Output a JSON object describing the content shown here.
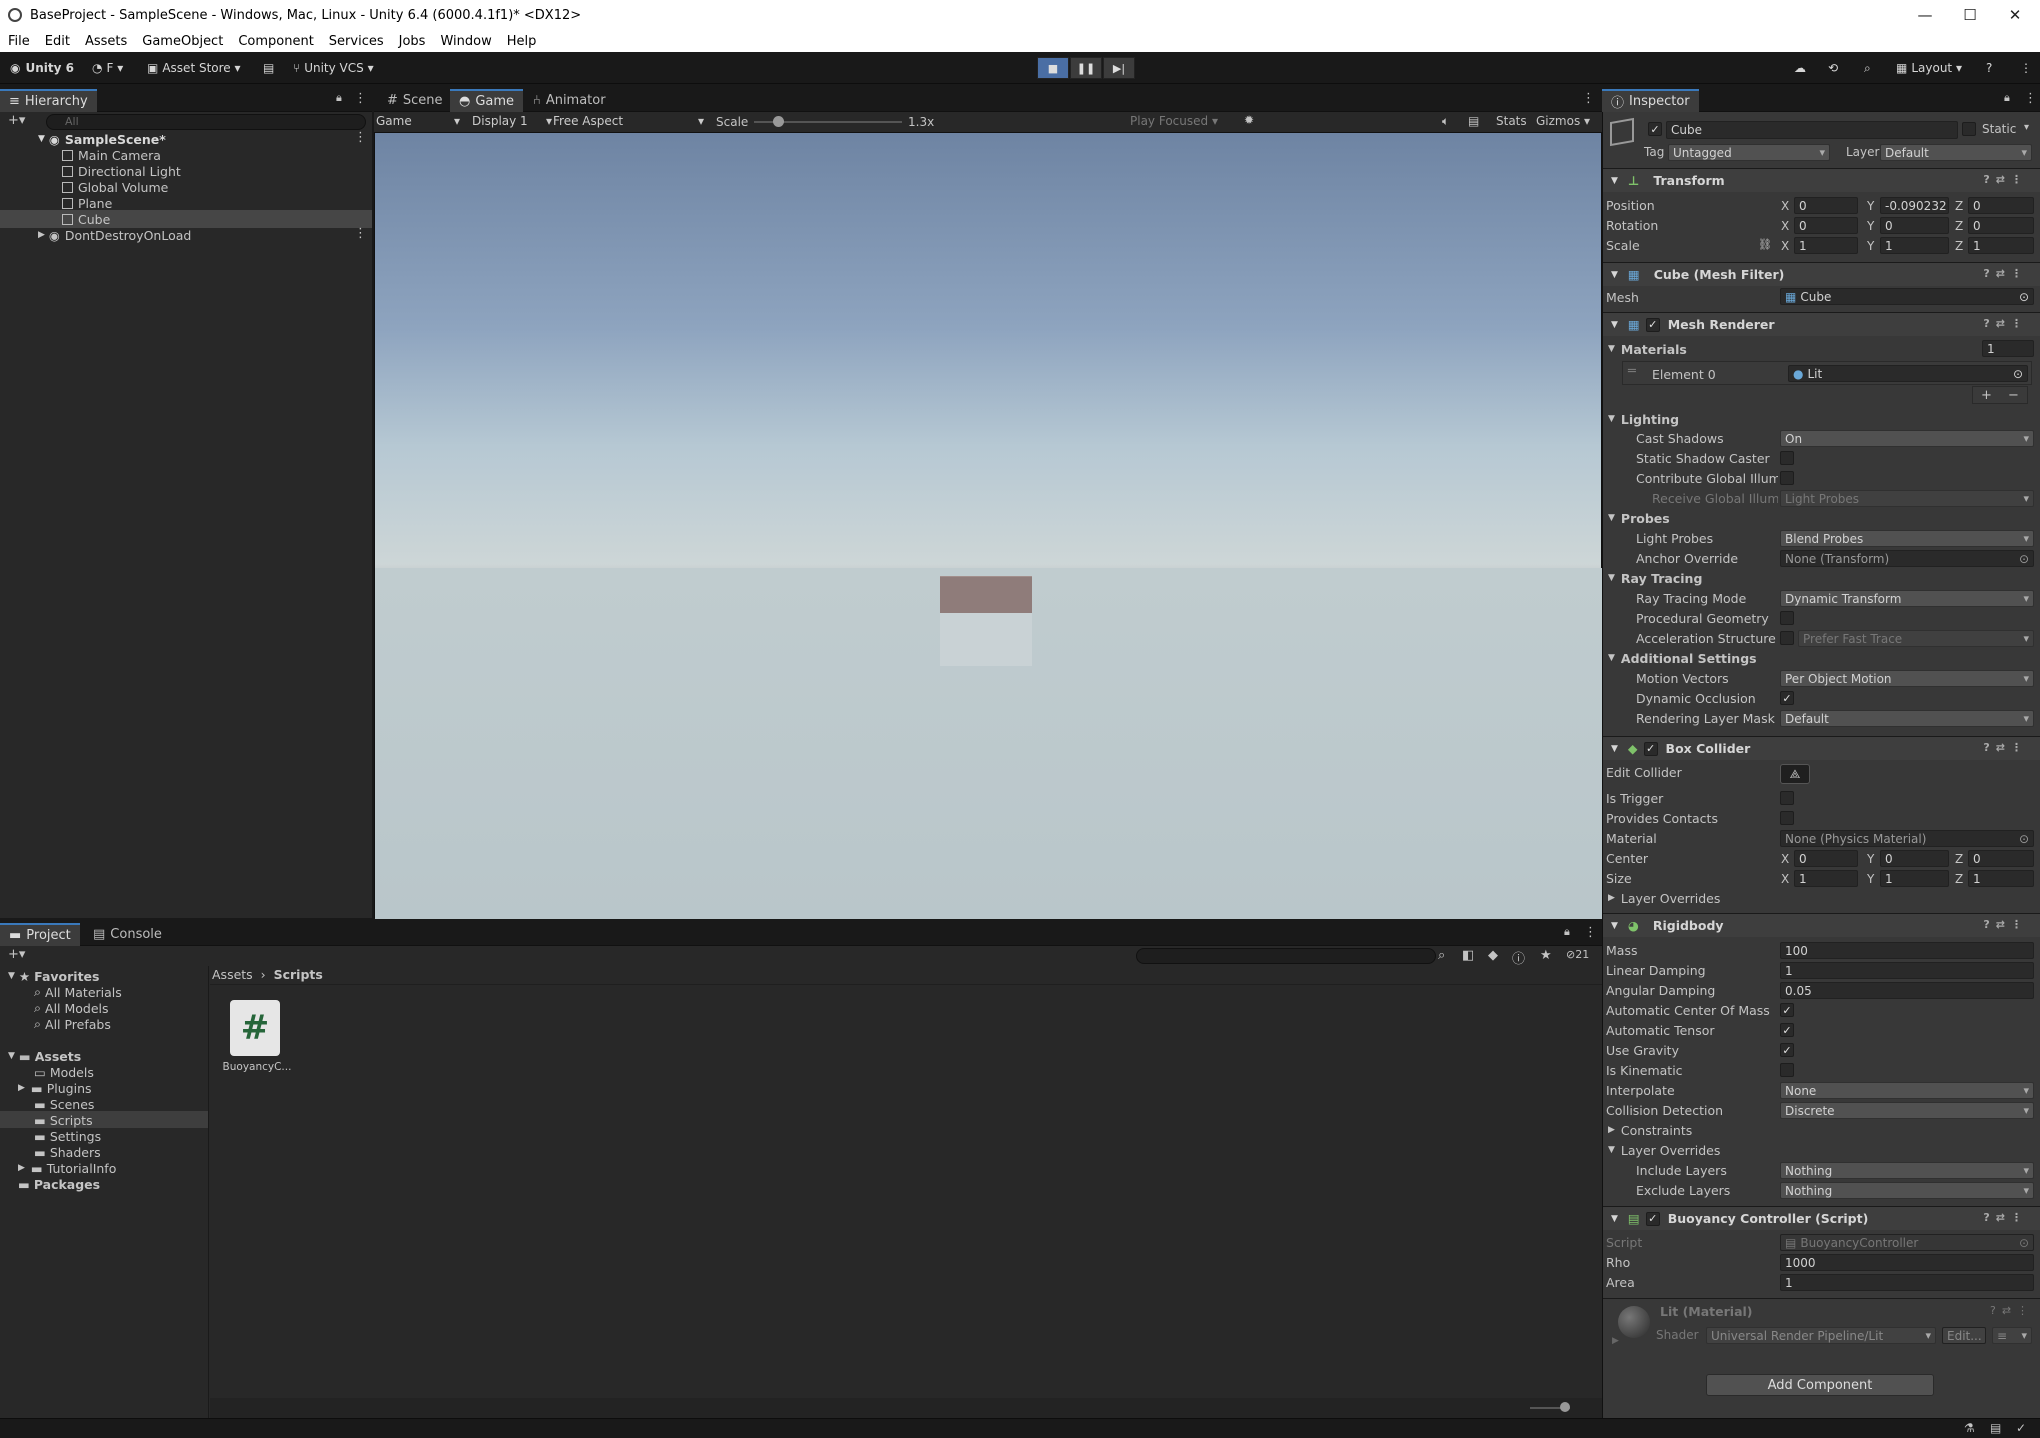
{
  "window": {
    "title": "BaseProject - SampleScene - Windows, Mac, Linux - Unity 6.4 (6000.4.1f1)* <DX12>"
  },
  "menu": [
    "File",
    "Edit",
    "Assets",
    "GameObject",
    "Component",
    "Services",
    "Jobs",
    "Window",
    "Help"
  ],
  "toolbar": {
    "unity": "Unity 6",
    "account": "F",
    "asset_store": "Asset Store",
    "vcs": "Unity VCS",
    "layout": "Layout"
  },
  "hierarchy": {
    "tab": "Hierarchy",
    "search_placeholder": "All",
    "scene": "SampleScene*",
    "items": [
      "Main Camera",
      "Directional Light",
      "Global Volume",
      "Plane",
      "Cube"
    ],
    "ddol": "DontDestroyOnLoad"
  },
  "center_tabs": [
    "Scene",
    "Game",
    "Animator"
  ],
  "game_bar": {
    "mode": "Game",
    "display": "Display 1",
    "aspect": "Free Aspect",
    "scale_label": "Scale",
    "scale_value": "1.3x",
    "play_focused": "Play Focused",
    "stats": "Stats",
    "gizmos": "Gizmos"
  },
  "project": {
    "tabs": [
      "Project",
      "Console"
    ],
    "hidden_count": "21",
    "favorites": "Favorites",
    "fav_items": [
      "All Materials",
      "All Models",
      "All Prefabs"
    ],
    "assets": "Assets",
    "folders": [
      "Models",
      "Plugins",
      "Scenes",
      "Scripts",
      "Settings",
      "Shaders",
      "TutorialInfo"
    ],
    "packages": "Packages",
    "breadcrumb": [
      "Assets",
      "Scripts"
    ],
    "file": "BuoyancyC..."
  },
  "inspector": {
    "tab": "Inspector",
    "object": "Cube",
    "static": "Static",
    "tag_label": "Tag",
    "tag": "Untagged",
    "layer_label": "Layer",
    "layer": "Default",
    "transform": {
      "title": "Transform",
      "position": "Position",
      "rotation": "Rotation",
      "scale": "Scale",
      "pos": [
        "0",
        "-0.090232",
        "0"
      ],
      "rot": [
        "0",
        "0",
        "0"
      ],
      "scl": [
        "1",
        "1",
        "1"
      ]
    },
    "mesh_filter": {
      "title": "Cube (Mesh Filter)",
      "mesh_label": "Mesh",
      "mesh": "Cube"
    },
    "mesh_renderer": {
      "title": "Mesh Renderer",
      "materials": "Materials",
      "count": "1",
      "element": "Element 0",
      "lit": "Lit",
      "lighting": "Lighting",
      "cast_shadows": "Cast Shadows",
      "cast_val": "On",
      "static_caster": "Static Shadow Caster",
      "contribute_gi": "Contribute Global Illumina",
      "receive_gi": "Receive Global Illumina",
      "receive_val": "Light Probes",
      "probes": "Probes",
      "light_probes": "Light Probes",
      "light_probes_val": "Blend Probes",
      "anchor": "Anchor Override",
      "anchor_val": "None (Transform)",
      "ray_tracing": "Ray Tracing",
      "rt_mode": "Ray Tracing Mode",
      "rt_mode_val": "Dynamic Transform",
      "procedural": "Procedural Geometry",
      "accel": "Acceleration Structure Bu",
      "accel_val": "Prefer Fast Trace",
      "additional": "Additional Settings",
      "motion": "Motion Vectors",
      "motion_val": "Per Object Motion",
      "occlusion": "Dynamic Occlusion",
      "rlm": "Rendering Layer Mask",
      "rlm_val": "Default"
    },
    "box_collider": {
      "title": "Box Collider",
      "edit": "Edit Collider",
      "trigger": "Is Trigger",
      "contacts": "Provides Contacts",
      "material": "Material",
      "material_val": "None (Physics Material)",
      "center": "Center",
      "center_v": [
        "0",
        "0",
        "0"
      ],
      "size": "Size",
      "size_v": [
        "1",
        "1",
        "1"
      ],
      "layer_overrides": "Layer Overrides"
    },
    "rigidbody": {
      "title": "Rigidbody",
      "mass": "Mass",
      "mass_val": "100",
      "lin": "Linear Damping",
      "lin_val": "1",
      "ang": "Angular Damping",
      "ang_val": "0.05",
      "acom": "Automatic Center Of Mass",
      "atensor": "Automatic Tensor",
      "gravity": "Use Gravity",
      "kinematic": "Is Kinematic",
      "interp": "Interpolate",
      "interp_val": "None",
      "coll": "Collision Detection",
      "coll_val": "Discrete",
      "constraints": "Constraints",
      "layer_overrides": "Layer Overrides",
      "include": "Include Layers",
      "include_val": "Nothing",
      "exclude": "Exclude Layers",
      "exclude_val": "Nothing"
    },
    "buoyancy": {
      "title": "Buoyancy Controller (Script)",
      "script": "Script",
      "script_val": "BuoyancyController",
      "rho": "Rho",
      "rho_val": "1000",
      "area": "Area",
      "area_val": "1"
    },
    "material": {
      "title": "Lit (Material)",
      "shader": "Shader",
      "shader_val": "Universal Render Pipeline/Lit",
      "edit": "Edit..."
    },
    "add_component": "Add Component"
  }
}
